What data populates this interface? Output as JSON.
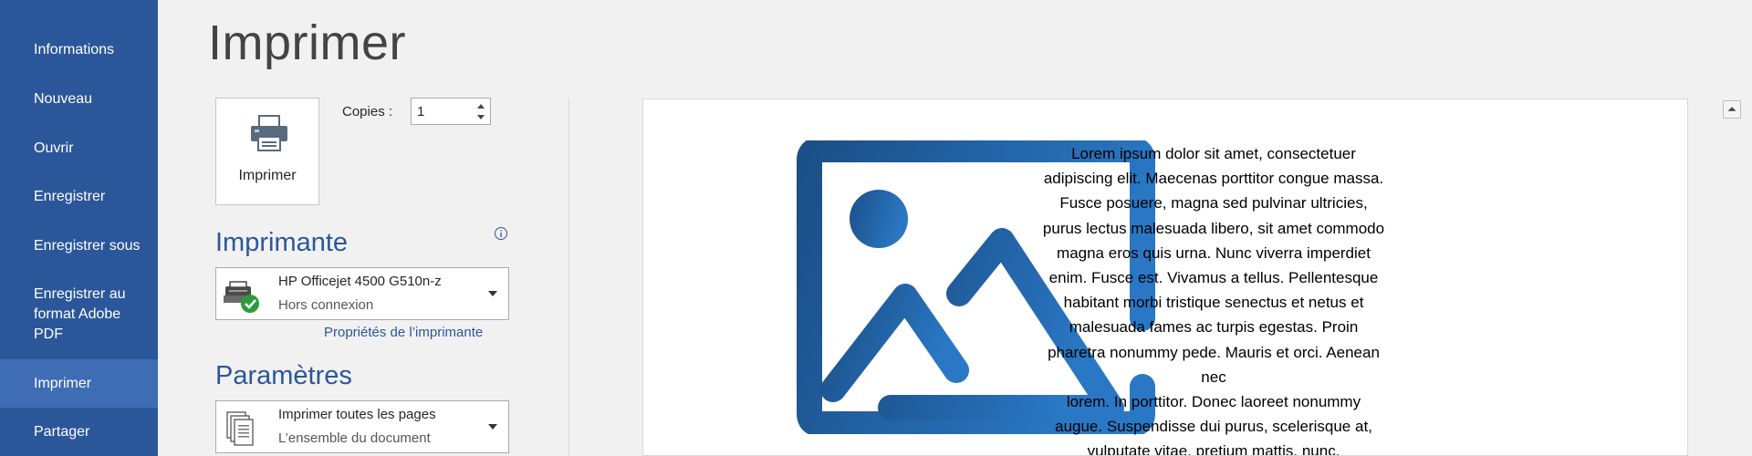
{
  "sidebar": {
    "items": [
      {
        "label": "Informations",
        "active": false
      },
      {
        "label": "Nouveau",
        "active": false
      },
      {
        "label": "Ouvrir",
        "active": false
      },
      {
        "label": "Enregistrer",
        "active": false
      },
      {
        "label": "Enregistrer sous",
        "active": false
      },
      {
        "label": "Enregistrer au\nformat Adobe\nPDF",
        "active": false
      },
      {
        "label": "Imprimer",
        "active": true
      },
      {
        "label": "Partager",
        "active": false
      }
    ]
  },
  "page_title": "Imprimer",
  "print_button": {
    "label": "Imprimer",
    "icon": "printer-icon"
  },
  "copies": {
    "label": "Copies :",
    "value": "1"
  },
  "printer_section": {
    "title": "Imprimante",
    "info_icon": "info-icon",
    "printer_name": "HP Officejet 4500 G510n-z",
    "printer_status": "Hors connexion",
    "properties_link": "Propriétés de l’imprimante"
  },
  "settings_section": {
    "title": "Paramètres",
    "pages_option": "Imprimer toutes les pages",
    "pages_option_desc": "L’ensemble du document"
  },
  "preview": {
    "image_icon": "picture-placeholder-icon",
    "text": "Lorem ipsum dolor sit amet, consectetuer\nadipiscing elit. Maecenas porttitor congue massa.\nFusce posuere, magna sed pulvinar ultricies,\npurus lectus malesuada libero, sit amet commodo\nmagna eros quis urna. Nunc viverra imperdiet\nenim. Fusce est. Vivamus a tellus. Pellentesque\nhabitant morbi tristique senectus et netus et\nmalesuada fames ac turpis egestas. Proin\npharetra nonummy pede. Mauris et orci. Aenean nec\nlorem. In porttitor. Donec laoreet nonummy\naugue. Suspendisse dui purus, scelerisque at,\nvulputate vitae, pretium mattis, nunc."
  },
  "colors": {
    "sidebar_bg": "#2b579a",
    "sidebar_active": "#3e6db5",
    "accent": "#2b579a",
    "page_bg": "#f1f1f1"
  }
}
